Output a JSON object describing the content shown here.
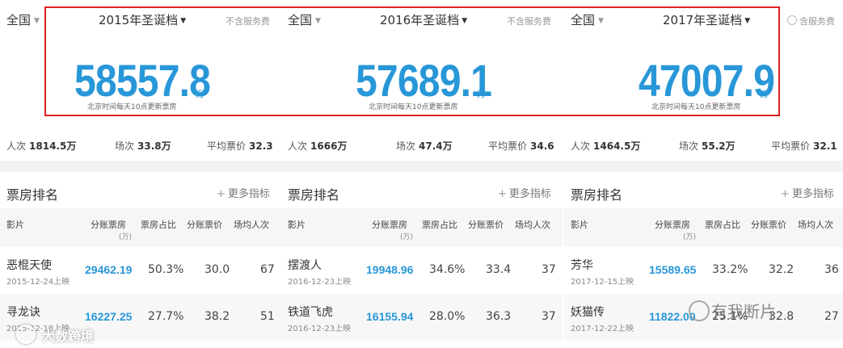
{
  "panels": [
    {
      "region": "全国",
      "period": "2015年圣诞档",
      "fee": "不含服务费",
      "box_total": "58557.8",
      "unit": "万",
      "note": "北京时间每天10点更新票房",
      "stats": {
        "admissions_label": "人次",
        "admissions": "1814.5万",
        "shows_label": "场次",
        "shows": "33.8万",
        "avg_label": "平均票价",
        "avg": "32.3"
      },
      "rank_title": "票房排名",
      "more": "更多指标",
      "headers": {
        "film": "影片",
        "box": "分账票房",
        "box_unit": "(万)",
        "share": "票房占比",
        "price": "分账票价",
        "per_show": "场均人次"
      },
      "rows": [
        {
          "name": "恶棍天使",
          "date": "2015-12-24上映",
          "box": "29462.19",
          "share": "50.3%",
          "price": "30.0",
          "per_show": "67"
        },
        {
          "name": "寻龙诀",
          "date": "2015-12-18上映",
          "box": "16227.25",
          "share": "27.7%",
          "price": "38.2",
          "per_show": "51"
        }
      ]
    },
    {
      "region": "全国",
      "period": "2016年圣诞档",
      "fee": "不含服务费",
      "box_total": "57689.1",
      "unit": "万",
      "note": "北京时间每天10点更新票房",
      "stats": {
        "admissions_label": "人次",
        "admissions": "1666万",
        "shows_label": "场次",
        "shows": "47.4万",
        "avg_label": "平均票价",
        "avg": "34.6"
      },
      "rank_title": "票房排名",
      "more": "更多指标",
      "headers": {
        "film": "影片",
        "box": "分账票房",
        "box_unit": "(万)",
        "share": "票房占比",
        "price": "分账票价",
        "per_show": "场均人次"
      },
      "rows": [
        {
          "name": "摆渡人",
          "date": "2016-12-23上映",
          "box": "19948.96",
          "share": "34.6%",
          "price": "33.4",
          "per_show": "37"
        },
        {
          "name": "铁道飞虎",
          "date": "2016-12-23上映",
          "box": "16155.94",
          "share": "28.0%",
          "price": "36.3",
          "per_show": "37"
        }
      ]
    },
    {
      "region": "全国",
      "period": "2017年圣诞档",
      "fee": "含服务费",
      "box_total": "47007.9",
      "unit": "万",
      "note": "北京时间每天10点更新票房",
      "stats": {
        "admissions_label": "人次",
        "admissions": "1464.5万",
        "shows_label": "场次",
        "shows": "55.2万",
        "avg_label": "平均票价",
        "avg": "32.1"
      },
      "rank_title": "票房排名",
      "more": "更多指标",
      "headers": {
        "film": "影片",
        "box": "分账票房",
        "box_unit": "(万)",
        "share": "票房占比",
        "price": "分账票价",
        "per_show": "场均人次"
      },
      "rows": [
        {
          "name": "芳华",
          "date": "2017-12-15上映",
          "box": "15589.65",
          "share": "33.2%",
          "price": "32.2",
          "per_show": "36"
        },
        {
          "name": "妖猫传",
          "date": "2017-12-22上映",
          "box": "11822.00",
          "share": "25.1%",
          "price": "32.8",
          "per_show": "27"
        }
      ]
    }
  ],
  "watermarks": {
    "right": "有我断片",
    "left": "大数跨境"
  },
  "colors": {
    "accent": "#2897d8",
    "highlight_box": "#e02020"
  }
}
